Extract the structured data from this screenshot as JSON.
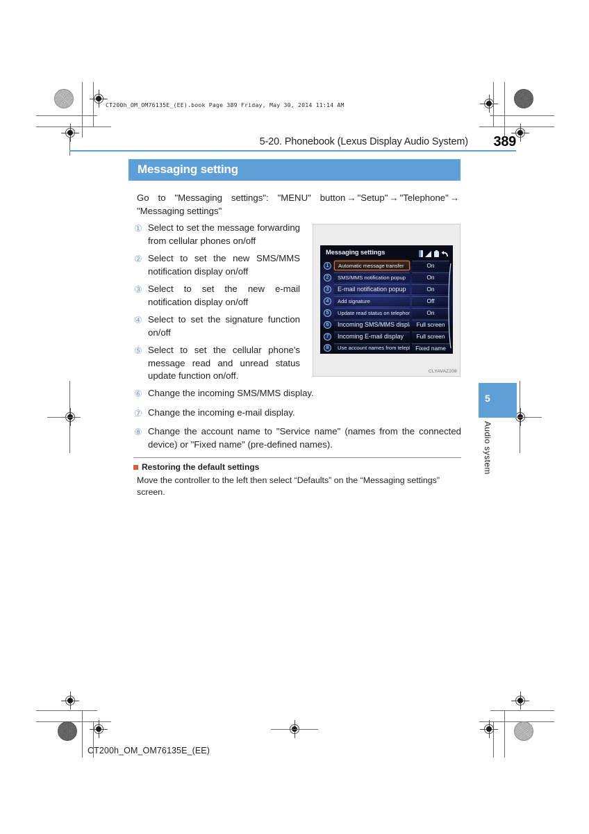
{
  "print_marks": {
    "filestamp": "CT200h_OM_OM76135E_(EE).book   Page 389   Friday, May 30, 2014   11:14 AM",
    "footer_code": "CT200h_OM_OM76135E_(EE)"
  },
  "header": {
    "title": "5-20. Phonebook (Lexus Display Audio System)",
    "page_number": "389",
    "rule_color": "#5b9fd9"
  },
  "section": {
    "banner_title": "Messaging setting",
    "banner_color": "#5e9fd8",
    "intro_prefix": "Go to \"Messaging settings\": \"MENU\" button",
    "intro_step1": "\"Setup\"",
    "intro_step2": "\"Telephone\"",
    "intro_step3": "\"Messaging settings\"",
    "arrow": "→"
  },
  "callouts_left": [
    {
      "num": "①",
      "text": "Select to set the message forwarding from cellular phones on/off"
    },
    {
      "num": "②",
      "text": "Select to set the new SMS/MMS notification display on/off"
    },
    {
      "num": "③",
      "text": "Select to set the new e-mail notification display on/off"
    },
    {
      "num": "④",
      "text": "Select to set the signature function on/off"
    },
    {
      "num": "⑤",
      "text": "Select to set the cellular phone's message read and unread status update function on/off."
    }
  ],
  "callouts_wide": [
    {
      "num": "⑥",
      "text": "Change the incoming SMS/MMS display."
    },
    {
      "num": "⑦",
      "text": "Change the incoming e-mail display."
    },
    {
      "num": "⑧",
      "text": "Change the account name to \"Service name\" (names from the connected device) or \"Fixed name\" (pre-defined names)."
    }
  ],
  "figure": {
    "caption": "CLYAVAZ208",
    "screen": {
      "title": "Messaging settings",
      "status_icons": [
        "bluetooth-icon",
        "signal-icon",
        "battery-icon",
        "return-icon"
      ],
      "rows": [
        {
          "num": "1",
          "label": "Automatic message transfer",
          "value": "On",
          "selected": true,
          "large": false
        },
        {
          "num": "2",
          "label": "SMS/MMS notification popup",
          "value": "On",
          "selected": false,
          "large": false
        },
        {
          "num": "3",
          "label": "E-mail notification popup",
          "value": "On",
          "selected": false,
          "large": true
        },
        {
          "num": "4",
          "label": "Add signature",
          "value": "Off",
          "selected": false,
          "large": false
        },
        {
          "num": "5",
          "label": "Update read status on telephone",
          "value": "On",
          "selected": false,
          "large": false
        },
        {
          "num": "6",
          "label": "Incoming SMS/MMS display",
          "value": "Full screen",
          "selected": false,
          "large": true
        },
        {
          "num": "7",
          "label": "Incoming E-mail display",
          "value": "Full screen",
          "selected": false,
          "large": true
        },
        {
          "num": "8",
          "label": "Use account names from telephone",
          "value": "Fixed name",
          "selected": false,
          "large": false
        }
      ]
    }
  },
  "restoring": {
    "heading": "Restoring the default settings",
    "body": "Move the controller to the left then select “Defaults” on the “Messaging settings” screen.",
    "bullet_color": "#d95f3b"
  },
  "chapter_tab": {
    "number": "5",
    "label": "Audio system",
    "color": "#5e9fd8"
  }
}
